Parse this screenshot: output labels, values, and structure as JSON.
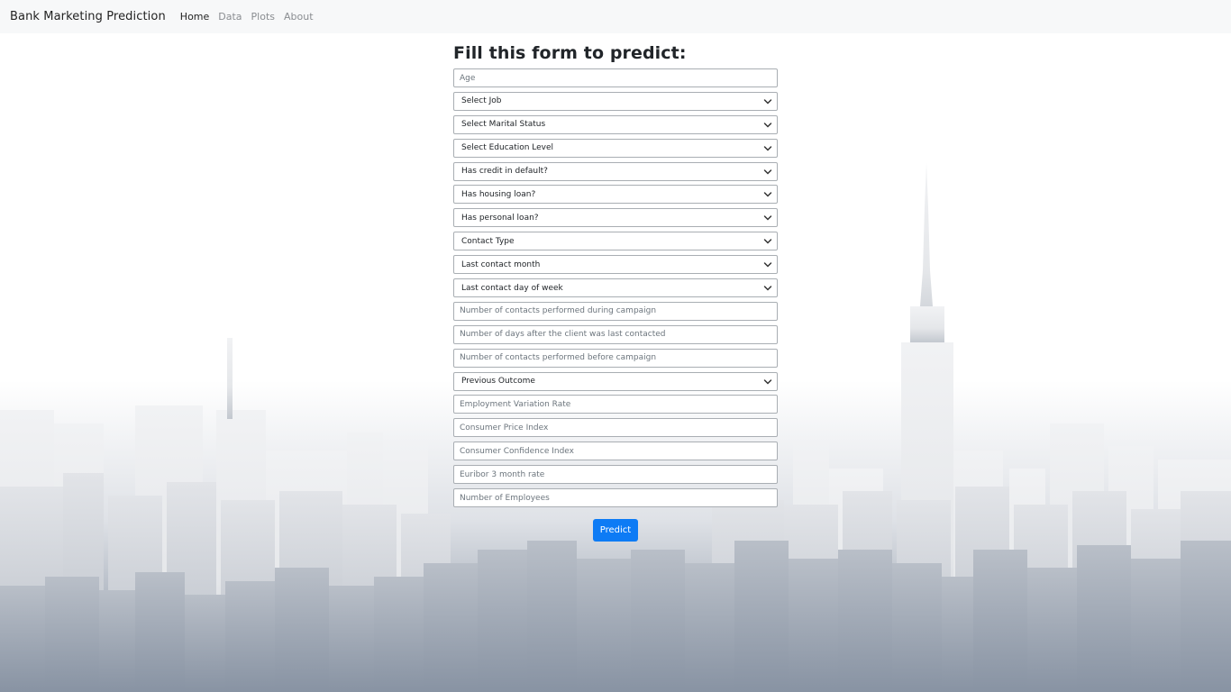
{
  "navbar": {
    "brand": "Bank Marketing Prediction",
    "links": [
      "Home",
      "Data",
      "Plots",
      "About"
    ],
    "active_index": 0
  },
  "form": {
    "title": "Fill this form to predict:",
    "fields": [
      {
        "type": "input",
        "placeholder": "Age"
      },
      {
        "type": "select",
        "value": "Select Job"
      },
      {
        "type": "select",
        "value": "Select Marital Status"
      },
      {
        "type": "select",
        "value": "Select Education Level"
      },
      {
        "type": "select",
        "value": "Has credit in default?"
      },
      {
        "type": "select",
        "value": "Has housing loan?"
      },
      {
        "type": "select",
        "value": "Has personal loan?"
      },
      {
        "type": "select",
        "value": "Contact Type"
      },
      {
        "type": "select",
        "value": "Last contact month"
      },
      {
        "type": "select",
        "value": "Last contact day of week"
      },
      {
        "type": "input",
        "placeholder": "Number of contacts performed during campaign"
      },
      {
        "type": "input",
        "placeholder": "Number of  days after the client was last contacted"
      },
      {
        "type": "input",
        "placeholder": "Number of contacts performed before campaign"
      },
      {
        "type": "select",
        "value": "Previous Outcome"
      },
      {
        "type": "input",
        "placeholder": "Employment Variation Rate"
      },
      {
        "type": "input",
        "placeholder": "Consumer Price Index"
      },
      {
        "type": "input",
        "placeholder": "Consumer Confidence Index"
      },
      {
        "type": "input",
        "placeholder": "Euribor 3 month rate"
      },
      {
        "type": "input",
        "placeholder": "Number of Employees"
      }
    ],
    "submit_label": "Predict"
  },
  "colors": {
    "accent": "#0d7bf5",
    "navbar_bg": "#f7f8f9"
  },
  "icons": {
    "select_arrow": "chevron-down-icon"
  }
}
